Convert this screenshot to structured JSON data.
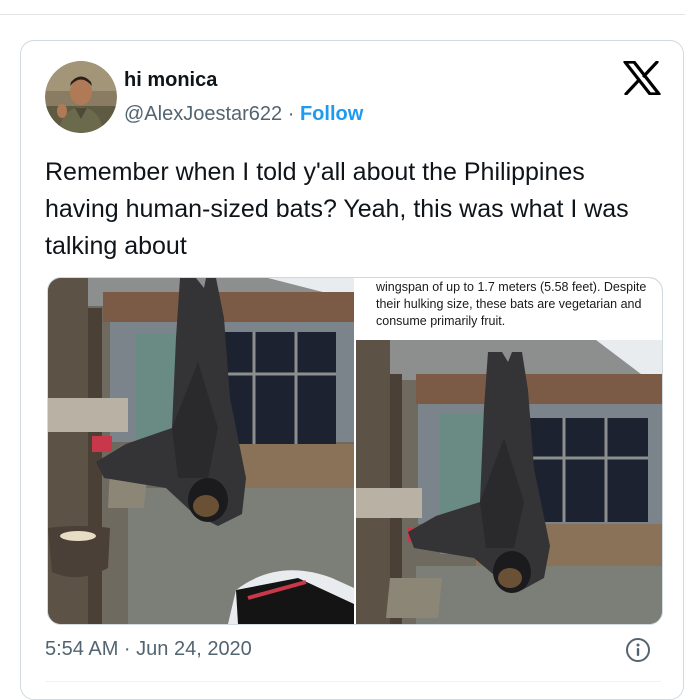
{
  "author": {
    "name": "hi monica",
    "handle": "@AlexJoestar622",
    "separator": "·",
    "follow_label": "Follow"
  },
  "tweet": {
    "text": "Remember when I told y'all about the Philippines having human-sized bats? Yeah, this was what I was talking about"
  },
  "media": {
    "caption": "wingspan of up to 1.7 meters (5.58 feet). Despite their hulking size, these bats are vegetarian and consume primarily fruit."
  },
  "timestamp": "5:54 AM · Jun 24, 2020",
  "icons": {
    "brand": "x-logo-icon",
    "info": "info-icon"
  },
  "colors": {
    "accent": "#1d9bf0",
    "text": "#0f1419",
    "secondary": "#536471"
  }
}
